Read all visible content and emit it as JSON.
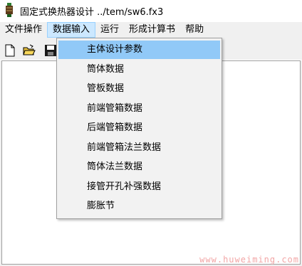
{
  "window": {
    "title": "固定式换热器设计 ../tem/sw6.fx3",
    "icon": "app-icon"
  },
  "menubar": {
    "items": [
      {
        "label": "文件操作"
      },
      {
        "label": "数据输入",
        "open": true
      },
      {
        "label": "运行"
      },
      {
        "label": "形成计算书"
      },
      {
        "label": "帮助"
      }
    ]
  },
  "toolbar": {
    "buttons": [
      {
        "icon": "new-file-icon"
      },
      {
        "icon": "open-folder-icon"
      },
      {
        "icon": "save-icon"
      }
    ]
  },
  "dropdown": {
    "items": [
      {
        "label": "主体设计参数",
        "highlighted": true
      },
      {
        "label": "筒体数据"
      },
      {
        "label": "管板数据"
      },
      {
        "label": "前端管箱数据"
      },
      {
        "label": "后端管箱数据"
      },
      {
        "label": "前端管箱法兰数据"
      },
      {
        "label": "筒体法兰数据"
      },
      {
        "label": "接管开孔补强数据"
      },
      {
        "label": "膨胀节"
      }
    ]
  },
  "watermark": {
    "text": "www.huweiming.com"
  },
  "colors": {
    "menu_open_bg": "#cce8ff",
    "item_highlight": "#91c9f7",
    "chrome_bg": "#f0f0f0",
    "watermark": "#f2a6a6"
  }
}
